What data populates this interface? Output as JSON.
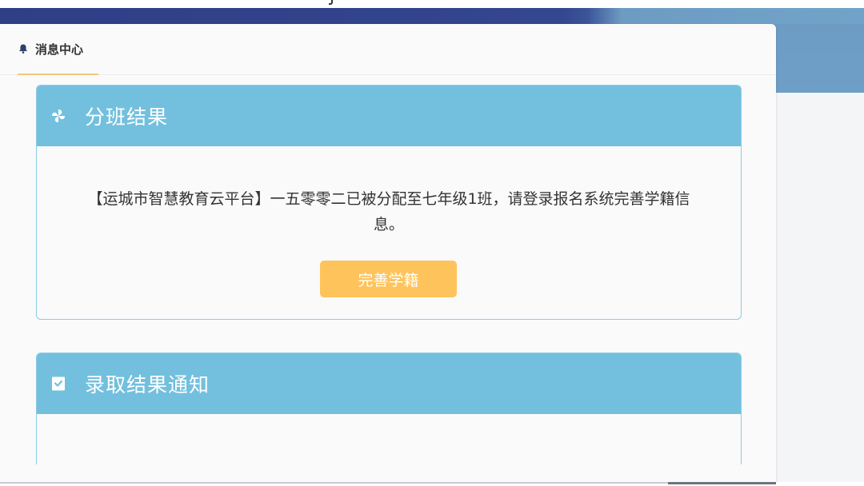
{
  "tabs": [
    {
      "label": "消息中心",
      "icon": "bell-icon",
      "active": true
    }
  ],
  "cards": [
    {
      "title": "分班结果",
      "icon": "pinwheel-icon",
      "message": "【运城市智慧教育云平台】一五零零二已被分配至七年级1班，请登录报名系统完善学籍信息。",
      "button_label": "完善学籍"
    },
    {
      "title": "录取结果通知",
      "icon": "clipboard-check-icon"
    }
  ],
  "colors": {
    "header_band": "#34468e",
    "card_header": "#72c0de",
    "card_border": "#8ecbe4",
    "button": "#ffc35c",
    "tab_underline": "#f5c77a"
  }
}
